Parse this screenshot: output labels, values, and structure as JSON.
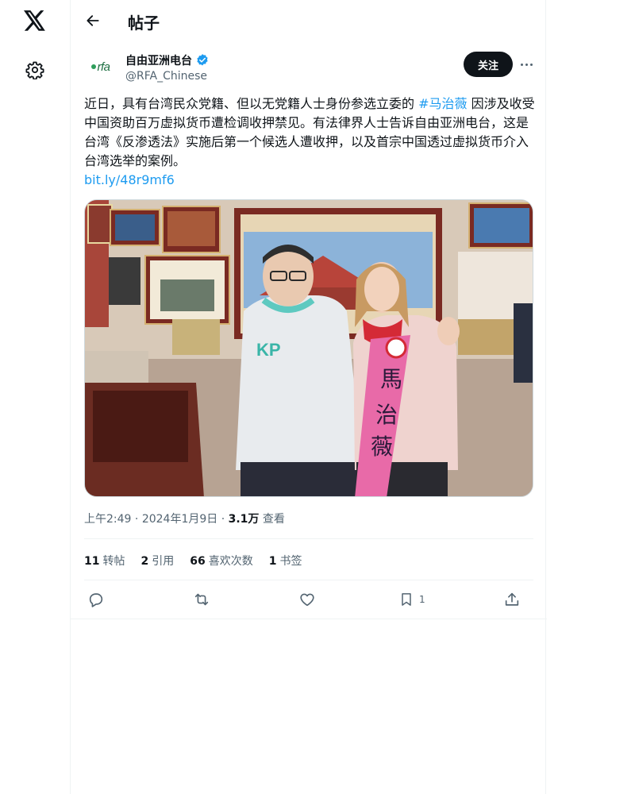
{
  "nav": {
    "logo_icon": "x-logo-icon",
    "settings_icon": "gear-icon"
  },
  "header": {
    "title": "帖子",
    "back_icon": "arrow-left-icon"
  },
  "author": {
    "avatar_text": "rfa",
    "name": "自由亚洲电台",
    "handle": "@RFA_Chinese",
    "verified": true
  },
  "follow_label": "关注",
  "tweet": {
    "text_before": "近日，具有台湾民众党籍、但以无党籍人士身份参选立委的 ",
    "hashtag": "#马治薇",
    "text_after": " 因涉及收受中国资助百万虚拟货币遭检调收押禁见。有法律界人士告诉自由亚洲电台，这是台湾《反渗透法》实施后第一个候选人遭收押，以及首宗中国透过虚拟货币介入台湾选举的案例。",
    "link": "bit.ly/48r9mf6"
  },
  "meta": {
    "time": "上午2:49",
    "date": "2024年1月9日",
    "views_count": "3.1万",
    "views_label": "查看",
    "separator": " · "
  },
  "stats": [
    {
      "count": "11",
      "label": "转帖"
    },
    {
      "count": "2",
      "label": "引用"
    },
    {
      "count": "66",
      "label": "喜欢次数"
    },
    {
      "count": "1",
      "label": "书签"
    }
  ],
  "actions": {
    "reply_icon": "reply-icon",
    "repost_icon": "repost-icon",
    "like_icon": "heart-icon",
    "bookmark_icon": "bookmark-icon",
    "bookmark_count": "1",
    "share_icon": "share-icon"
  },
  "colors": {
    "accent": "#1d9bf0",
    "text": "#0f1419",
    "muted": "#536471",
    "border": "#eff3f4"
  }
}
